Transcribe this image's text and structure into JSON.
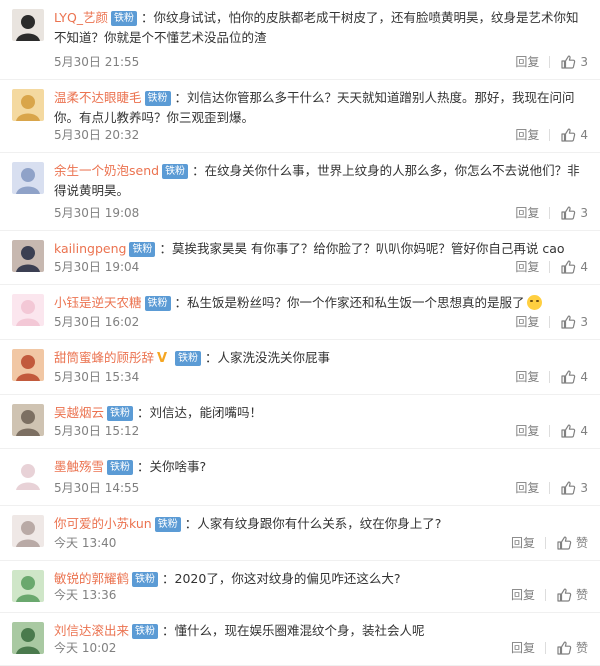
{
  "badge_label": "铁粉",
  "reply_label": "回复",
  "like_icon": "thumbs-up-icon",
  "colors": {
    "username": "#eb7350",
    "badge": "#5b9bd5",
    "meta": "#808080",
    "text": "#333333"
  },
  "comments": [
    {
      "username": "LYQ_艺颜",
      "vip": false,
      "text": "你纹身试试，怕你的皮肤都老成干树皮了，还有脸喷黄明昊，纹身是艺术你知不知道？你就是个不懂艺术没品位的渣",
      "emoji": false,
      "time": "5月30日 21:55",
      "likes": "3"
    },
    {
      "username": "温柔不达眼睫毛",
      "vip": false,
      "text": "刘信达你管那么多干什么？天天就知道蹭别人热度。那好，我现在问问你。有点儿教养吗？你三观歪到爆。",
      "emoji": false,
      "time": "5月30日 20:32",
      "likes": "4"
    },
    {
      "username": "余生一个奶泡send",
      "vip": false,
      "text": "在纹身关你什么事，世界上纹身的人那么多，你怎么不去说他们？非得说黄明昊。",
      "emoji": false,
      "time": "5月30日 19:08",
      "likes": "3"
    },
    {
      "username": "kailingpeng",
      "vip": false,
      "text": "莫挨我家昊昊 有你事了？给你脸了？叭叭你妈呢？管好你自己再说 cao",
      "emoji": false,
      "time": "5月30日 19:04",
      "likes": "4"
    },
    {
      "username": "小钰是逆天农糖",
      "vip": false,
      "text": "私生饭是粉丝吗？你一个作家还和私生饭一个思想真的是服了",
      "emoji": true,
      "time": "5月30日 16:02",
      "likes": "3"
    },
    {
      "username": "甜筒蜜蜂的顾彤辞",
      "vip": true,
      "vip_glyph": "V",
      "text": "人家洗没洗关你屁事",
      "emoji": false,
      "time": "5月30日 15:34",
      "likes": "4"
    },
    {
      "username": "吴越烟云",
      "vip": false,
      "text": "刘信达，能闭嘴吗！",
      "emoji": false,
      "time": "5月30日 15:12",
      "likes": "4"
    },
    {
      "username": "墨触殇雪",
      "vip": false,
      "text": "关你啥事?",
      "emoji": false,
      "time": "5月30日 14:55",
      "likes": "3"
    },
    {
      "username": "你可爱的小苏kun",
      "vip": false,
      "text": "人家有纹身跟你有什么关系，纹在你身上了?",
      "emoji": false,
      "time": "今天 13:40",
      "likes": "赞"
    },
    {
      "username": "敏锐的郭耀鹤",
      "vip": false,
      "text": "2020了，你这对纹身的偏见咋还这么大?",
      "emoji": false,
      "time": "今天 13:36",
      "likes": "赞"
    },
    {
      "username": "刘信达滚出来",
      "vip": false,
      "text": "懂什么，现在娱乐圈难混纹个身，装社会人呢",
      "emoji": false,
      "time": "今天 10:02",
      "likes": "赞"
    }
  ]
}
